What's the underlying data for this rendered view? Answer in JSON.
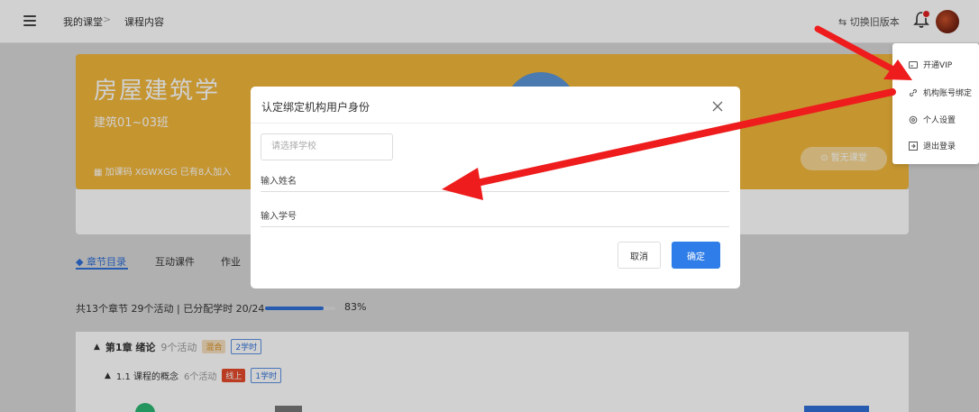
{
  "topbar": {
    "breadcrumb_home": "我的课堂",
    "breadcrumb_current": "课程内容",
    "breadcrumb_sep": ">",
    "switch_version": "⇆ 切换旧版本"
  },
  "course": {
    "title": "房屋建筑学",
    "class_name": "建筑01~03班",
    "code_line": "▦ 加课码 XGWXGG   已有8人加入",
    "no_class_button": "⊙  暂无课堂"
  },
  "tabs": [
    "章节目录",
    "互动课件",
    "作业"
  ],
  "tab_active_prefix": "◆ ",
  "stats": {
    "text": "共13个章节   29个活动   |   已分配学时 20/24",
    "progress_percent": 83,
    "percent_label": "83%"
  },
  "chapters": [
    {
      "title": "第1章 绪论",
      "activity_count": "9个活动",
      "mode_tag": "混合",
      "hours_tag": "2学时"
    }
  ],
  "sections": [
    {
      "title": "1.1 课程的概念",
      "activity_count": "6个活动",
      "mode_tag": "线上",
      "hours_tag": "1学时"
    }
  ],
  "dropdown": {
    "items": [
      {
        "label": "开通VIP",
        "icon": "vip-card-icon"
      },
      {
        "label": "机构账号绑定",
        "icon": "link-icon"
      },
      {
        "label": "个人设置",
        "icon": "gear-icon"
      },
      {
        "label": "退出登录",
        "icon": "logout-icon"
      }
    ]
  },
  "modal": {
    "title": "认定绑定机构用户身份",
    "school_placeholder": "请选择学校",
    "name_placeholder": "输入姓名",
    "student_id_placeholder": "输入学号",
    "cancel_label": "取消",
    "ok_label": "确定"
  },
  "colors": {
    "course_card": "#f1b63b",
    "primary": "#2f7de8",
    "annotation_arrow": "#ee1c1c"
  }
}
